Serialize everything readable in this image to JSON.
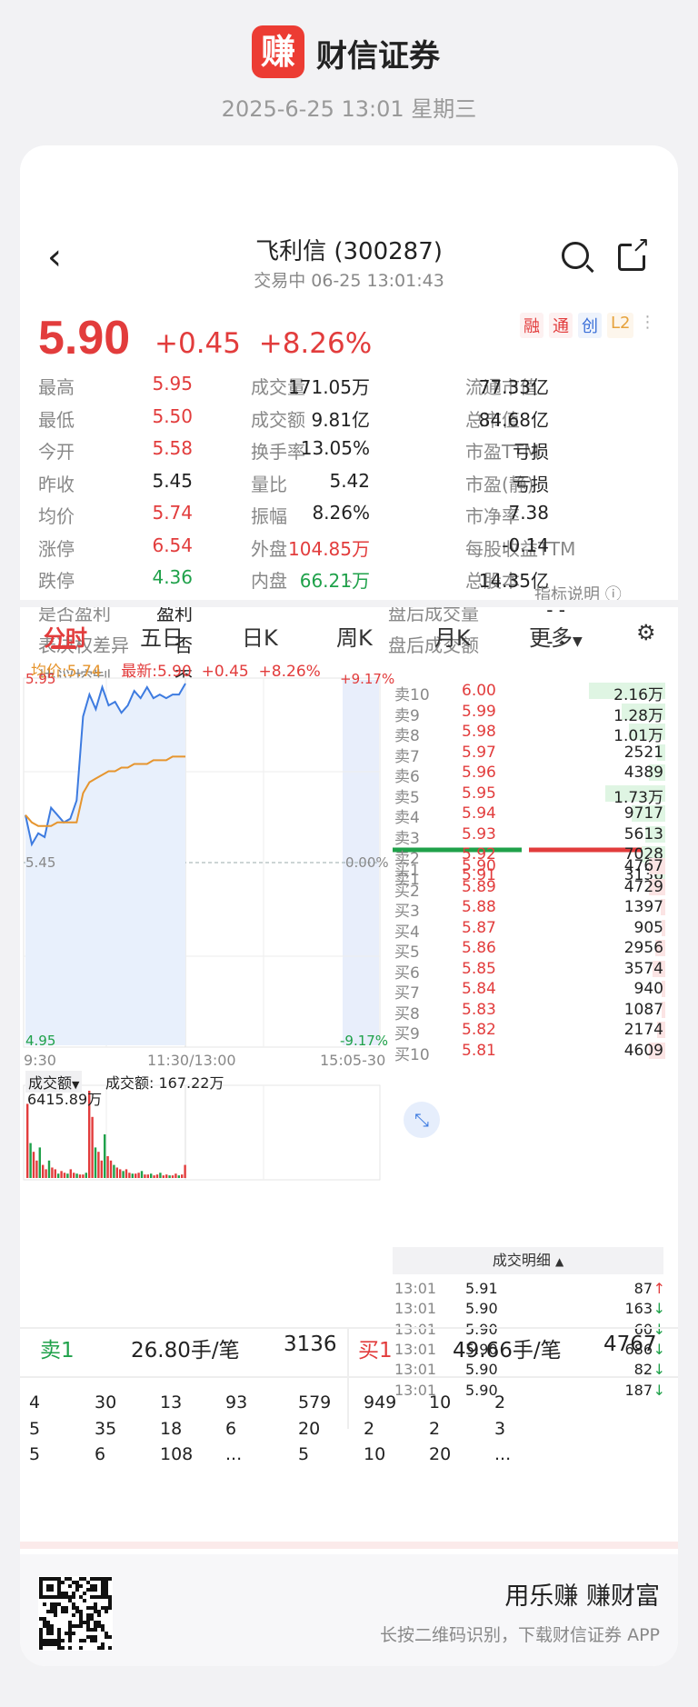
{
  "header": {
    "logo_char": "赚",
    "brand": "财信证券",
    "timestamp": "2025-6-25 13:01 星期三"
  },
  "nav": {
    "back_icon": "chevron-left-icon",
    "title": "飞利信 (300287)",
    "subtitle": "交易中   06-25   13:01:43",
    "search_icon": "search-icon",
    "share_icon": "share-icon"
  },
  "quote": {
    "price": "5.90",
    "change": "+0.45",
    "change_pct": "+8.26%",
    "tags": [
      "融",
      "通",
      "创",
      "L2"
    ]
  },
  "stats": [
    [
      {
        "label": "最高",
        "value": "5.95",
        "color": "red"
      },
      {
        "label": "成交量",
        "value": "171.05万",
        "color": "dark"
      },
      {
        "label": "流通市值",
        "value": "77.33亿",
        "color": "dark"
      }
    ],
    [
      {
        "label": "最低",
        "value": "5.50",
        "color": "red"
      },
      {
        "label": "成交额",
        "value": "9.81亿",
        "color": "dark"
      },
      {
        "label": "总市值",
        "value": "84.68亿",
        "color": "dark"
      }
    ],
    [
      {
        "label": "今开",
        "value": "5.58",
        "color": "red"
      },
      {
        "label": "换手率",
        "value": "13.05%",
        "color": "dark"
      },
      {
        "label": "市盈TTM",
        "value": "亏损",
        "color": "dark"
      }
    ],
    [
      {
        "label": "昨收",
        "value": "5.45",
        "color": "dark"
      },
      {
        "label": "量比",
        "value": "5.42",
        "color": "dark"
      },
      {
        "label": "市盈(静)",
        "value": "亏损",
        "color": "dark"
      }
    ],
    [
      {
        "label": "均价",
        "value": "5.74",
        "color": "red"
      },
      {
        "label": "振幅",
        "value": "8.26%",
        "color": "dark"
      },
      {
        "label": "市净率",
        "value": "7.38",
        "color": "dark"
      }
    ],
    [
      {
        "label": "涨停",
        "value": "6.54",
        "color": "red"
      },
      {
        "label": "外盘",
        "value": "104.85万",
        "color": "red"
      },
      {
        "label": "每股收益TTM",
        "value": "-0.14",
        "color": "dark"
      }
    ],
    [
      {
        "label": "跌停",
        "value": "4.36",
        "color": "green"
      },
      {
        "label": "内盘",
        "value": "66.21万",
        "color": "green"
      },
      {
        "label": "总股本",
        "value": "14.35亿",
        "color": "dark"
      }
    ]
  ],
  "extra": [
    {
      "l1": "是否盈利",
      "v1": "盈利",
      "l2": "盘后成交量",
      "v2": "- -"
    },
    {
      "l1": "表决权差异",
      "v1": "否",
      "l2": "盘后成交额",
      "v2": "- -"
    },
    {
      "l1": "协议控制",
      "v1": "否",
      "l2": "",
      "v2": ""
    }
  ],
  "indicator_link": "指标说明",
  "tabs": [
    "分时",
    "五日",
    "日K",
    "周K",
    "月K",
    "更多"
  ],
  "chart": {
    "avg_label": "均价:5.74",
    "latest_label": "最新:5.90",
    "latest_chg": "+0.45",
    "latest_pct": "+8.26%",
    "y_top": "5.95",
    "y_mid": "5.45",
    "y_bot": "4.95",
    "pct_top": "+9.17%",
    "pct_mid": "0.00%",
    "pct_bot": "-9.17%",
    "x_left": "9:30",
    "x_mid": "11:30/13:00",
    "x_right": "15:05-30",
    "vol_selector": "成交额",
    "vol_total": "成交额: 167.22万",
    "vol_max": "6415.89万"
  },
  "chart_data": {
    "type": "line",
    "ylim": [
      4.95,
      5.95
    ],
    "series": [
      {
        "x": [
          0,
          0.02,
          0.04,
          0.06,
          0.08,
          0.1,
          0.12,
          0.14,
          0.16,
          0.18,
          0.2,
          0.22,
          0.24,
          0.26,
          0.28,
          0.3,
          0.32,
          0.34,
          0.36,
          0.38,
          0.4,
          0.42,
          0.44,
          0.46,
          0.48,
          0.5
        ],
        "values": [
          5.58,
          5.5,
          5.53,
          5.52,
          5.6,
          5.58,
          5.56,
          5.57,
          5.62,
          5.85,
          5.91,
          5.87,
          5.93,
          5.88,
          5.89,
          5.86,
          5.88,
          5.92,
          5.9,
          5.93,
          5.9,
          5.91,
          5.9,
          5.91,
          5.91,
          5.94
        ]
      },
      {
        "x": [
          0,
          0.02,
          0.04,
          0.06,
          0.08,
          0.1,
          0.12,
          0.14,
          0.16,
          0.18,
          0.2,
          0.22,
          0.24,
          0.26,
          0.28,
          0.3,
          0.32,
          0.34,
          0.36,
          0.38,
          0.4,
          0.42,
          0.44,
          0.46,
          0.48,
          0.5
        ],
        "values": [
          5.58,
          5.56,
          5.55,
          5.55,
          5.55,
          5.56,
          5.56,
          5.56,
          5.56,
          5.64,
          5.67,
          5.68,
          5.69,
          5.7,
          5.7,
          5.71,
          5.71,
          5.72,
          5.72,
          5.72,
          5.73,
          5.73,
          5.73,
          5.74,
          5.74,
          5.74
        ]
      }
    ]
  },
  "volume_bars": [
    0.85,
    0.4,
    0.3,
    0.2,
    0.35,
    0.15,
    0.1,
    0.2,
    0.12,
    0.1,
    0.05,
    0.08,
    0.06,
    0.05,
    0.1,
    0.06,
    0.05,
    0.04,
    0.04,
    0.06,
    1.0,
    0.7,
    0.35,
    0.3,
    0.2,
    0.5,
    0.25,
    0.2,
    0.15,
    0.12,
    0.1,
    0.08,
    0.1,
    0.06,
    0.05,
    0.05,
    0.06,
    0.08,
    0.04,
    0.04,
    0.05,
    0.03,
    0.04,
    0.06,
    0.03,
    0.04,
    0.03,
    0.03,
    0.05,
    0.03,
    0.04,
    0.15
  ],
  "orderbook": {
    "asks": [
      {
        "label": "卖10",
        "price": "6.00",
        "vol": "2.16万",
        "bar": 0.95
      },
      {
        "label": "卖9",
        "price": "5.99",
        "vol": "1.28万",
        "bar": 0.55
      },
      {
        "label": "卖8",
        "price": "5.98",
        "vol": "1.01万",
        "bar": 0.45
      },
      {
        "label": "卖7",
        "price": "5.97",
        "vol": "2521",
        "bar": 0.1
      },
      {
        "label": "卖6",
        "price": "5.96",
        "vol": "4389",
        "bar": 0.2
      },
      {
        "label": "卖5",
        "price": "5.95",
        "vol": "1.73万",
        "bar": 0.75
      },
      {
        "label": "卖4",
        "price": "5.94",
        "vol": "9717",
        "bar": 0.42
      },
      {
        "label": "卖3",
        "price": "5.93",
        "vol": "5613",
        "bar": 0.25
      },
      {
        "label": "卖2",
        "price": "5.92",
        "vol": "7028",
        "bar": 0.3
      },
      {
        "label": "卖1",
        "price": "5.91",
        "vol": "3136",
        "bar": 0.14
      }
    ],
    "bids": [
      {
        "label": "买1",
        "price": "5.90",
        "vol": "4767",
        "bar": 0.2
      },
      {
        "label": "买2",
        "price": "5.89",
        "vol": "4729",
        "bar": 0.2
      },
      {
        "label": "买3",
        "price": "5.88",
        "vol": "1397",
        "bar": 0.06
      },
      {
        "label": "买4",
        "price": "5.87",
        "vol": "905",
        "bar": 0.04
      },
      {
        "label": "买5",
        "price": "5.86",
        "vol": "2956",
        "bar": 0.13
      },
      {
        "label": "买6",
        "price": "5.85",
        "vol": "3574",
        "bar": 0.16
      },
      {
        "label": "买7",
        "price": "5.84",
        "vol": "940",
        "bar": 0.04
      },
      {
        "label": "买8",
        "price": "5.83",
        "vol": "1087",
        "bar": 0.05
      },
      {
        "label": "买9",
        "price": "5.82",
        "vol": "2174",
        "bar": 0.1
      },
      {
        "label": "买10",
        "price": "5.81",
        "vol": "4609",
        "bar": 0.2
      }
    ]
  },
  "tape_header": "成交明细",
  "tape": [
    {
      "t": "13:01",
      "p": "5.91",
      "v": "87",
      "dir": "up"
    },
    {
      "t": "13:01",
      "p": "5.90",
      "v": "163",
      "dir": "down"
    },
    {
      "t": "13:01",
      "p": "5.90",
      "v": "60",
      "dir": "down"
    },
    {
      "t": "13:01",
      "p": "5.90",
      "v": "686",
      "dir": "down"
    },
    {
      "t": "13:01",
      "p": "5.90",
      "v": "82",
      "dir": "down"
    },
    {
      "t": "13:01",
      "p": "5.90",
      "v": "187",
      "dir": "down"
    }
  ],
  "bottom": {
    "sell_label": "卖1",
    "sell_avg": "26.80手/笔",
    "sell_vol": "3136",
    "buy_label": "买1",
    "buy_avg": "49.66手/笔",
    "buy_vol": "4767",
    "sell_grid": [
      [
        "4",
        "30",
        "13",
        "93"
      ],
      [
        "5",
        "35",
        "18",
        "6"
      ],
      [
        "5",
        "6",
        "108",
        "..."
      ]
    ],
    "buy_grid": [
      [
        "579",
        "949",
        "10",
        "2"
      ],
      [
        "20",
        "2",
        "2",
        "3"
      ],
      [
        "5",
        "10",
        "20",
        "..."
      ]
    ]
  },
  "footer": {
    "slogan": "用乐赚 赚财富",
    "hint": "长按二维码识别，下载财信证券 APP"
  }
}
